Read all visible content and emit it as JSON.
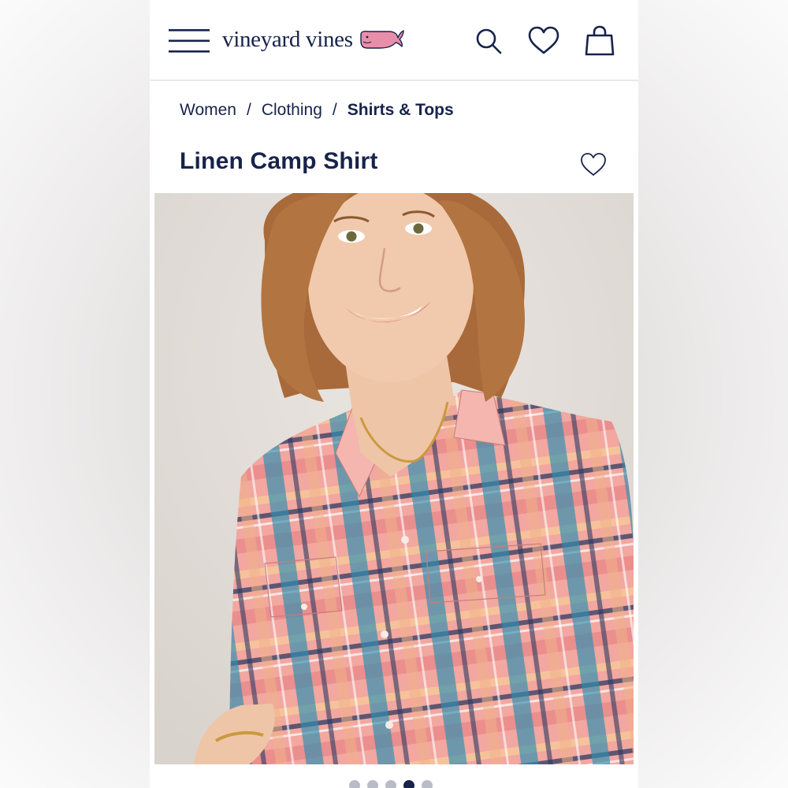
{
  "header": {
    "menu_icon": "hamburger-menu-icon",
    "brand_name": "vineyard vines",
    "brand_logo": "whale-logo",
    "search_icon": "search-icon",
    "wishlist_icon": "heart-icon",
    "bag_icon": "shopping-bag-icon"
  },
  "breadcrumb": {
    "items": [
      "Women",
      "Clothing",
      "Shirts & Tops"
    ],
    "separator": "/"
  },
  "product": {
    "title": "Linen Camp Shirt",
    "favorite_icon": "heart-outline-icon"
  },
  "gallery": {
    "image_alt": "Smiling model wearing a pink and blue plaid linen camp shirt",
    "dot_count": 5,
    "active_dot": 4
  },
  "colors": {
    "navy": "#17234b",
    "whale_pink": "#e98ea8",
    "divider": "#e8e9ee"
  }
}
